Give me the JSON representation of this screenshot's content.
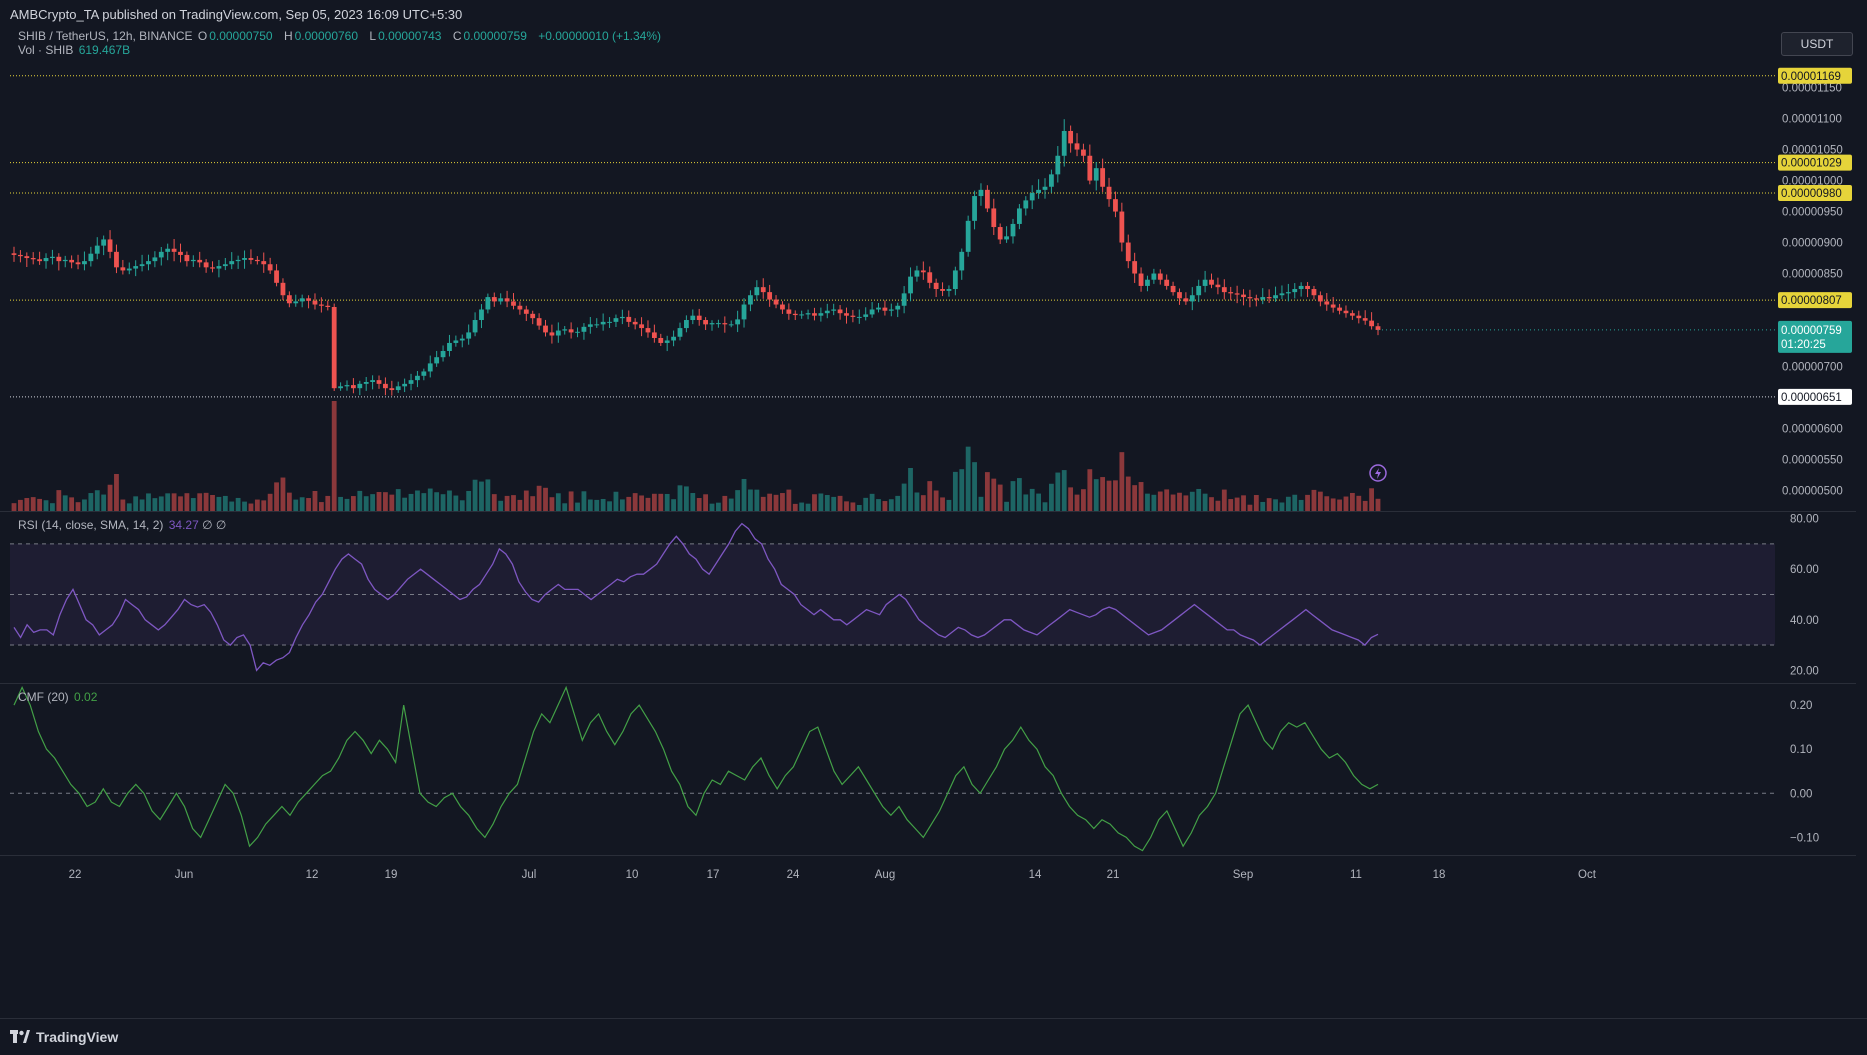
{
  "header": {
    "published": "AMBCrypto_TA published on TradingView.com, Sep 05, 2023 16:09 UTC+5:30"
  },
  "legend": {
    "symbol": "SHIB / TetherUS, 12h, BINANCE",
    "o_label": "O",
    "o_value": "0.00000750",
    "h_label": "H",
    "h_value": "0.00000760",
    "l_label": "L",
    "l_value": "0.00000743",
    "c_label": "C",
    "c_value": "0.00000759",
    "change": "+0.00000010 (+1.34%)",
    "vol_label": "Vol · SHIB",
    "vol_value": "619.467B",
    "rsi_label": "RSI (14, close, SMA, 14, 2)",
    "rsi_value": "34.27",
    "rsi_extra": "∅ ∅",
    "cmf_label": "CMF (20)",
    "cmf_value": "0.02"
  },
  "currency_badge": "USDT",
  "footer": {
    "brand": "TradingView"
  },
  "colors": {
    "background": "#131722",
    "up": "#26a69a",
    "down": "#ef5350",
    "level_line": "#e6d43a",
    "rsi": "#7e57c2",
    "cmf": "#43a047"
  },
  "chart_data": [
    {
      "type": "candlestick",
      "title": "SHIB / TetherUS, 12h, BINANCE",
      "x_ticks": [
        "22",
        "Jun",
        "12",
        "19",
        "Jul",
        "10",
        "17",
        "24",
        "Aug",
        "14",
        "21",
        "Sep",
        "11",
        "18",
        "Oct"
      ],
      "y_ticks": [
        "0.00001150",
        "0.00001100",
        "0.00001050",
        "0.00001000",
        "0.00000950",
        "0.00000900",
        "0.00000850",
        "0.00000700",
        "0.00000600",
        "0.00000550",
        "0.00000500"
      ],
      "ylim": [
        4.83e-06,
        1.23e-05
      ],
      "levels": [
        {
          "label": "0.00001169",
          "value": 1.169e-05,
          "style": "yellow-dotted"
        },
        {
          "label": "0.00001029",
          "value": 1.029e-05,
          "style": "yellow-dotted"
        },
        {
          "label": "0.00000980",
          "value": 9.8e-06,
          "style": "yellow-dotted"
        },
        {
          "label": "0.00000807",
          "value": 8.07e-06,
          "style": "yellow-dotted"
        },
        {
          "label": "0.00000651",
          "value": 6.51e-06,
          "style": "white-dotted"
        }
      ],
      "last_price": {
        "label": "0.00000759",
        "countdown": "01:20:25"
      },
      "closes_approx": [
        8.8e-06,
        8.78e-06,
        8.75e-06,
        8.73e-06,
        8.7e-06,
        8.75e-06,
        8.77e-06,
        8.7e-06,
        8.72e-06,
        8.68e-06,
        8.65e-06,
        8.7e-06,
        8.82e-06,
        8.95e-06,
        9.05e-06,
        8.85e-06,
        8.6e-06,
        8.55e-06,
        8.58e-06,
        8.62e-06,
        8.65e-06,
        8.7e-06,
        8.76e-06,
        8.85e-06,
        8.9e-06,
        8.85e-06,
        8.8e-06,
        8.7e-06,
        8.72e-06,
        8.68e-06,
        8.6e-06,
        8.58e-06,
        8.62e-06,
        8.65e-06,
        8.7e-06,
        8.72e-06,
        8.75e-06,
        8.72e-06,
        8.7e-06,
        8.65e-06,
        8.55e-06,
        8.35e-06,
        8.15e-06,
        8.02e-06,
        8.05e-06,
        8.1e-06,
        8.06e-06,
        8e-06,
        7.98e-06,
        7.96e-06,
        6.65e-06,
        6.68e-06,
        6.7e-06,
        6.65e-06,
        6.72e-06,
        6.75e-06,
        6.78e-06,
        6.72e-06,
        6.65e-06,
        6.62e-06,
        6.68e-06,
        6.72e-06,
        6.78e-06,
        6.85e-06,
        6.92e-06,
        7.05e-06,
        7.15e-06,
        7.25e-06,
        7.38e-06,
        7.42e-06,
        7.45e-06,
        7.55e-06,
        7.75e-06,
        7.92e-06,
        8.12e-06,
        8.05e-06,
        8.1e-06,
        8.05e-06,
        7.98e-06,
        7.92e-06,
        7.85e-06,
        7.78e-06,
        7.66e-06,
        7.55e-06,
        7.5e-06,
        7.58e-06,
        7.6e-06,
        7.55e-06,
        7.56e-06,
        7.64e-06,
        7.68e-06,
        7.68e-06,
        7.72e-06,
        7.72e-06,
        7.78e-06,
        7.8e-06,
        7.72e-06,
        7.68e-06,
        7.62e-06,
        7.55e-06,
        7.46e-06,
        7.38e-06,
        7.42e-06,
        7.48e-06,
        7.62e-06,
        7.75e-06,
        7.82e-06,
        7.75e-06,
        7.68e-06,
        7.7e-06,
        7.7e-06,
        7.68e-06,
        7.68e-06,
        7.76e-06,
        8e-06,
        8.15e-06,
        8.28e-06,
        8.2e-06,
        8.08e-06,
        8e-06,
        7.92e-06,
        7.85e-06,
        7.83e-06,
        7.84e-06,
        7.86e-06,
        7.82e-06,
        7.86e-06,
        7.9e-06,
        7.92e-06,
        7.86e-06,
        7.82e-06,
        7.8e-06,
        7.8e-06,
        7.84e-06,
        7.92e-06,
        7.95e-06,
        7.9e-06,
        7.92e-06,
        7.98e-06,
        8.18e-06,
        8.45e-06,
        8.55e-06,
        8.52e-06,
        8.35e-06,
        8.25e-06,
        8.22e-06,
        8.25e-06,
        8.55e-06,
        8.85e-06,
        9.35e-06,
        9.75e-06,
        9.85e-06,
        9.55e-06,
        9.25e-06,
        9.05e-06,
        9.1e-06,
        9.3e-06,
        9.55e-06,
        9.68e-06,
        9.8e-06,
        9.85e-06,
        9.9e-06,
        1.01e-05,
        1.04e-05,
        1.08e-05,
        1.06e-05,
        1.05e-05,
        1.04e-05,
        1e-05,
        1.02e-05,
        9.9e-06,
        9.7e-06,
        9.5e-06,
        9e-06,
        8.7e-06,
        8.5e-06,
        8.3e-06,
        8.4e-06,
        8.5e-06,
        8.4e-06,
        8.3e-06,
        8.2e-06,
        8.1e-06,
        8.05e-06,
        8.15e-06,
        8.3e-06,
        8.4e-06,
        8.32e-06,
        8.28e-06,
        8.2e-06,
        8.18e-06,
        8.16e-06,
        8.12e-06,
        8.1e-06,
        8.08e-06,
        8.12e-06,
        8.1e-06,
        8.15e-06,
        8.18e-06,
        8.2e-06,
        8.25e-06,
        8.3e-06,
        8.25e-06,
        8.15e-06,
        8.05e-06,
        8e-06,
        7.95e-06,
        7.9e-06,
        7.86e-06,
        7.82e-06,
        7.78e-06,
        7.74e-06,
        7.65e-06,
        7.59e-06
      ]
    },
    {
      "type": "line",
      "title": "RSI (14, close, SMA, 14, 2)",
      "y_ticks": [
        "80.00",
        "60.00",
        "40.00",
        "20.00"
      ],
      "ylim": [
        15,
        83
      ],
      "bands": [
        70,
        50,
        30
      ],
      "last_value": 34.27
    },
    {
      "type": "line",
      "title": "CMF (20)",
      "y_ticks": [
        "0.20",
        "0.10",
        "0.00",
        "−0.10"
      ],
      "ylim": [
        -0.14,
        0.25
      ],
      "last_value": 0.02
    }
  ]
}
